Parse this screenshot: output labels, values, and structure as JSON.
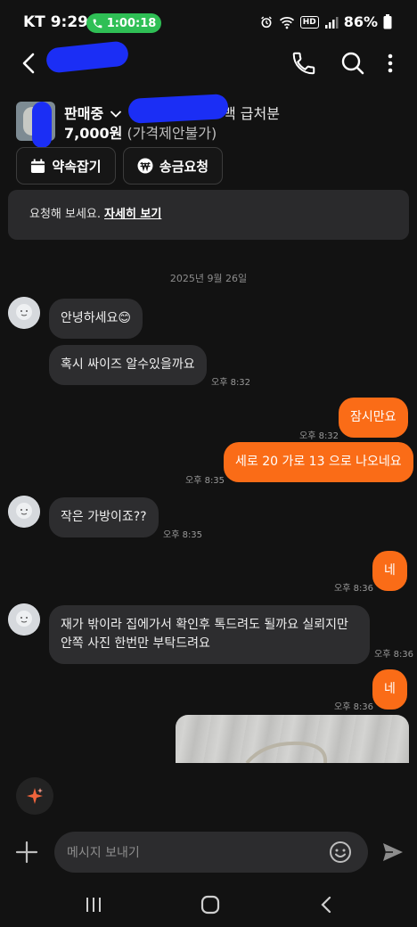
{
  "status_bar": {
    "carrier_time": "KT 9:29",
    "call_timer": "1:00:18",
    "battery": "86%",
    "network_badge": "HD"
  },
  "header": {
    "title": ""
  },
  "product": {
    "status": "판매중",
    "title_visible_part": "백 급처분",
    "price": "7,000원",
    "price_note": "(가격제안불가)",
    "buttons": {
      "appointment": "약속잡기",
      "transfer": "송금요청"
    }
  },
  "notice": {
    "text": "요청해 보세요.",
    "link": "자세히 보기"
  },
  "chat": {
    "date": "2025년 9월 26일",
    "messages": [
      {
        "side": "in",
        "text": "안녕하세요😊",
        "time": ""
      },
      {
        "side": "in",
        "text": "혹시 싸이즈 알수있을까요",
        "time": "오후 8:32"
      },
      {
        "side": "out",
        "text": "잠시만요",
        "time": "오후 8:32"
      },
      {
        "side": "out",
        "text": "세로 20 가로 13 으로 나오네요",
        "time": "오후 8:35"
      },
      {
        "side": "in",
        "text": "작은 가방이죠??",
        "time": "오후 8:35"
      },
      {
        "side": "out",
        "text": "네",
        "time": "오후 8:36"
      },
      {
        "side": "in",
        "text_line1": "재가 밖이라  집에가서  확인후 톡드려도 될까요  실뢰지만",
        "text_line2": "안쪽 사진 한번만 부탁드려요",
        "time": "오후 8:36"
      },
      {
        "side": "out",
        "text": "네",
        "time": "오후 8:36"
      }
    ]
  },
  "composer": {
    "placeholder": "메시지 보내기"
  },
  "colors": {
    "accent": "#fa6c17",
    "background": "#121212",
    "incoming_bubble": "#2d2d2f",
    "call_pill": "#2fbf55",
    "redaction": "#1b2ef5"
  },
  "icons": [
    "back-icon",
    "phone-icon",
    "search-icon",
    "more-icon",
    "calendar-icon",
    "won-icon",
    "sparkle-icon",
    "plus-icon",
    "emoji-icon",
    "send-icon",
    "recent-apps-icon",
    "home-icon",
    "nav-back-icon"
  ]
}
